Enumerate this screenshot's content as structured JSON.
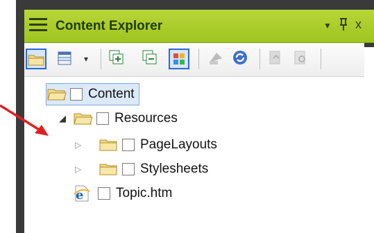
{
  "panel": {
    "title": "Content Explorer",
    "title_controls": {
      "dropdown": "▼",
      "pin": "🖈",
      "close": "x"
    }
  },
  "toolbar": {
    "items": [
      "folder-toggle-icon",
      "view-menu-icon",
      "dropdown-icon",
      "new-folder-icon",
      "collapse-icon",
      "grid-icon",
      "import-icon",
      "refresh-icon",
      "check-in-icon",
      "check-out-icon"
    ]
  },
  "tree": {
    "items": [
      {
        "label": "Content",
        "level": 0,
        "icon": "folder-open-icon",
        "expanded": true,
        "selected": true
      },
      {
        "label": "Resources",
        "level": 1,
        "icon": "folder-open-icon",
        "expanded": true
      },
      {
        "label": "PageLayouts",
        "level": 2,
        "icon": "folder-icon",
        "expanded": false
      },
      {
        "label": "Stylesheets",
        "level": 2,
        "icon": "folder-icon",
        "expanded": false
      },
      {
        "label": "Topic.htm",
        "level": 1,
        "icon": "ie-page-icon"
      }
    ]
  },
  "colors": {
    "titlebar": "#a6c926",
    "frame": "#3a3a3a",
    "selection": "#dbe9f9",
    "annotation_arrow": "#e02020"
  }
}
